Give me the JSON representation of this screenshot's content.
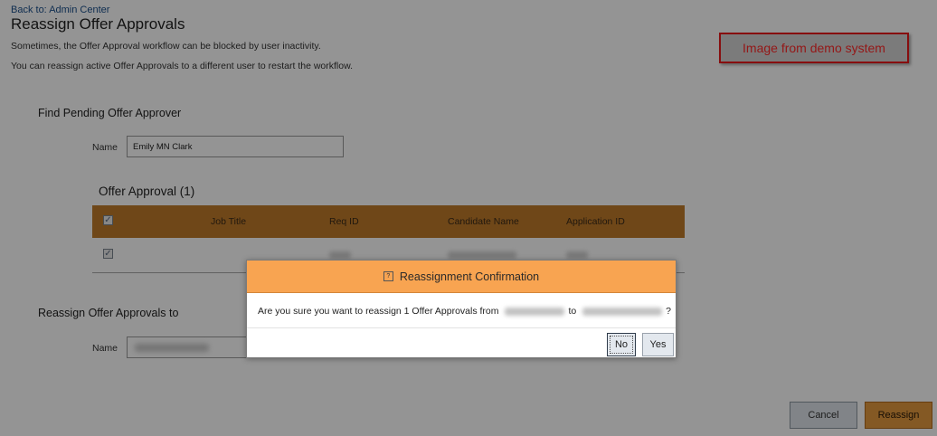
{
  "header": {
    "back_link": "Back to: Admin Center",
    "title": "Reassign Offer Approvals",
    "description_1": "Sometimes, the Offer Approval workflow can be blocked by user inactivity.",
    "description_2": "You can reassign active Offer Approvals to a different user to restart the workflow."
  },
  "demo_note": {
    "text": "Image from demo system",
    "border_color": "#e8191b",
    "text_color": "#ff2a2a"
  },
  "find_section": {
    "heading": "Find Pending Offer Approver",
    "name_label": "Name",
    "name_value": "Emily MN Clark"
  },
  "offer_table": {
    "heading": "Offer Approval (1)",
    "header_color": "#c07a2a",
    "columns": [
      "Job Title",
      "Req ID",
      "Candidate Name",
      "Application ID"
    ],
    "rows": [
      {
        "checked": true,
        "cells_redacted": true
      }
    ],
    "header_checkbox_checked": true,
    "checkbox_glyph": "✓"
  },
  "reassign_section": {
    "heading": "Reassign Offer Approvals to",
    "name_label": "Name",
    "name_value_redacted": true
  },
  "buttons": {
    "cancel": "Cancel",
    "reassign": "Reassign",
    "reassign_color": "#e39a3f"
  },
  "dialog": {
    "title": "Reassignment Confirmation",
    "header_color": "#f8a451",
    "help_icon_glyph": "?",
    "message_prefix": "Are you sure you want to reassign 1 Offer Approvals from",
    "message_middle": "to",
    "message_suffix": "?",
    "no_label": "No",
    "yes_label": "Yes"
  }
}
